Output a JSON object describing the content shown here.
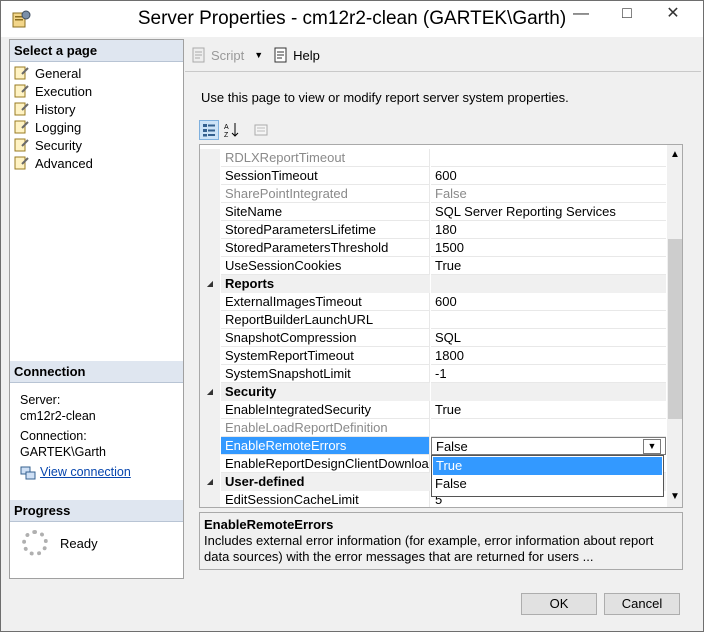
{
  "window": {
    "title": "Server Properties - cm12r2-clean (GARTEK\\Garth)"
  },
  "select_page": {
    "heading": "Select a page",
    "items": [
      {
        "label": "General"
      },
      {
        "label": "Execution"
      },
      {
        "label": "History"
      },
      {
        "label": "Logging"
      },
      {
        "label": "Security"
      },
      {
        "label": "Advanced"
      }
    ]
  },
  "connection": {
    "heading": "Connection",
    "server_label": "Server:",
    "server_value": "cm12r2-clean",
    "connection_label": "Connection:",
    "connection_value": "GARTEK\\Garth",
    "view_link": "View connection"
  },
  "progress": {
    "heading": "Progress",
    "status": "Ready"
  },
  "toolbar": {
    "script_label": "Script",
    "help_label": "Help"
  },
  "main": {
    "description": "Use this page to view or modify report server system properties."
  },
  "grid": {
    "rows": [
      {
        "name": "RDLXReportTimeout",
        "value": "",
        "dim": true
      },
      {
        "name": "SessionTimeout",
        "value": "600"
      },
      {
        "name": "SharePointIntegrated",
        "value": "False",
        "dim": true
      },
      {
        "name": "SiteName",
        "value": "SQL Server Reporting Services"
      },
      {
        "name": "StoredParametersLifetime",
        "value": "180"
      },
      {
        "name": "StoredParametersThreshold",
        "value": "1500"
      },
      {
        "name": "UseSessionCookies",
        "value": "True"
      },
      {
        "name": "Reports",
        "value": "",
        "category": true
      },
      {
        "name": "ExternalImagesTimeout",
        "value": "600"
      },
      {
        "name": "ReportBuilderLaunchURL",
        "value": ""
      },
      {
        "name": "SnapshotCompression",
        "value": "SQL"
      },
      {
        "name": "SystemReportTimeout",
        "value": "1800"
      },
      {
        "name": "SystemSnapshotLimit",
        "value": "-1"
      },
      {
        "name": "Security",
        "value": "",
        "category": true
      },
      {
        "name": "EnableIntegratedSecurity",
        "value": "True"
      },
      {
        "name": "EnableLoadReportDefinition",
        "value": "",
        "dim": true
      },
      {
        "name": "EnableRemoteErrors",
        "value": "False",
        "selected": true
      },
      {
        "name": "EnableReportDesignClientDownload",
        "value": ""
      },
      {
        "name": "User-defined",
        "value": "",
        "category": true
      },
      {
        "name": "EditSessionCacheLimit",
        "value": "5"
      }
    ],
    "dropdown_options": [
      "True",
      "False"
    ],
    "dropdown_highlighted": "True"
  },
  "help": {
    "title": "EnableRemoteErrors",
    "text": "Includes external error information (for example, error information about report data sources) with the error messages that are returned for users ..."
  },
  "buttons": {
    "ok": "OK",
    "cancel": "Cancel"
  },
  "icons": {
    "title": "server-properties-icon",
    "page": "page-wrench-icon",
    "connection": "connection-icon",
    "script": "script-icon",
    "help": "help-icon",
    "categorized": "categorized-icon",
    "alphabetical": "alphabetical-sort-icon",
    "property_pages": "property-pages-icon"
  }
}
